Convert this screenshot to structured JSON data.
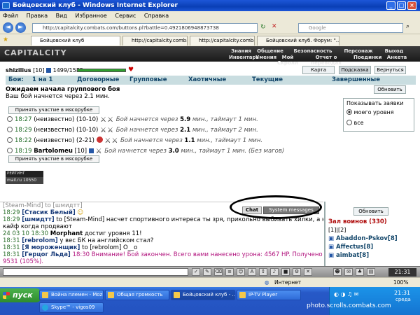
{
  "browser": {
    "title": "Бойцовский клуб - Windows Internet Explorer",
    "menu": [
      "Файл",
      "Правка",
      "Вид",
      "Избранное",
      "Сервис",
      "Справка"
    ],
    "address": "http://capitalcity.combats.com/buttons.pl?battle=0.4921806948873738",
    "search_placeholder": "Google",
    "tabs": [
      "Бойцовский клуб",
      "http://capitalcity.combats.co...",
      "http://capitalcity.combats.co...",
      "Бойцовский клуб. Форум: \"..."
    ]
  },
  "game": {
    "logo": "CAPITALCITY",
    "topnav": [
      "Знания",
      "Общение",
      "Безопасность",
      "Персонаж",
      "Выход",
      "Инвентарь",
      "Умения",
      "Мой Скролл",
      "Отчет о переводах",
      "Поединки",
      "Анкета"
    ],
    "user": {
      "name": "shizilius",
      "level": "[10]",
      "hp": "1499/1585"
    },
    "top_buttons": [
      "Карта миров",
      "Подсказка",
      "Вернуться"
    ],
    "battle_tabs": [
      "Бои:",
      "1 на 1",
      "Договорные",
      "Групповые",
      "Хаотичные",
      "Текущие",
      "Завершенные"
    ],
    "wait_title": "Ожидаем начала группового боя",
    "wait_sub": "Ваш бой начнется через 2.1 мин.",
    "refresh": "Обновить",
    "show_requests": {
      "title": "Показывать заявки",
      "options": [
        "моего уровня",
        "все"
      ]
    },
    "join_label": "Принять участие в мясорубке",
    "rows": [
      {
        "time": "18:27",
        "who": "(неизвестно)",
        "lv": "(10-10)",
        "info": "Бой начнется через",
        "mins": "5.9",
        "rest": "мин., таймаут 1 мин."
      },
      {
        "time": "18:29",
        "who": "(неизвестно)",
        "lv": "(10-10)",
        "info": "Бой начнется через",
        "mins": "2.1",
        "rest": "мин., таймаут 2 мин."
      },
      {
        "time": "18:22",
        "who": "(неизвестно)",
        "lv": "(2-21)",
        "info": "Бой начнется через",
        "mins": "1.1",
        "rest": "мин., таймаут 1 мин."
      },
      {
        "time": "18:19",
        "who": "Bartolomeu",
        "lv": "[10]",
        "info": "Бой начнется через",
        "mins": "3.0",
        "rest": "мин., таймаут 1 мин. (Без магов)"
      }
    ],
    "ratings": [
      "РЕЙТИНГ 146234666",
      "mail.ru 10550"
    ]
  },
  "chat": {
    "tabs": [
      "Chat",
      "System messages"
    ],
    "lines": [
      {
        "t": "",
        "n": "[Steam-Mind] to [шмидтт]",
        "m": ""
      },
      {
        "t": "18:29",
        "n": "[Стасик Белый]",
        "m": ""
      },
      {
        "t": "18:29",
        "n": "[шмидтт]",
        "m": "to [Steam-Mind] насчет спортивного интереса ты зря, прикольно выбивать хилки, а какой"
      },
      {
        "t": "",
        "n": "",
        "m": "кайф когда продвают"
      },
      {
        "t": "24 03 10 18:30",
        "n": "Morphant",
        "m": "достиг уровня 11!"
      },
      {
        "t": "18:31",
        "n": "[rebrolom]",
        "m": "у вес БК на английском стал?"
      },
      {
        "t": "18:31",
        "n": "[Я мороженщик]",
        "m": "to [rebrolom] O__o"
      },
      {
        "t": "18:31",
        "n": "[Герцог Льда]",
        "m": "18:30 Внимание! Бой закончен. Всего вами нанесено урона: 4567 HP. Получено опыта:"
      },
      {
        "t": "",
        "n": "",
        "m": "9531 (105%)."
      }
    ],
    "side": {
      "refresh": "Обновить",
      "room": "Зал воинов (330)",
      "pages": "[1]|[2]",
      "users": [
        "Abaddon-Pskov[8]",
        "Affectus[8]",
        "aimbat[8]"
      ]
    }
  },
  "statusbar": {
    "zone": "Интернет",
    "zoom": "100%"
  },
  "taskbar": {
    "start": "пуск",
    "tasks": [
      "Война племен - Mozilla...",
      "Общая громкость",
      "Бойцовский клуб - ...",
      "IP-TV Player",
      "Skype™ - vigos09"
    ],
    "time": "21:31",
    "day": "среда",
    "watermark": "photo.scrolls.combats.com"
  },
  "colors": {
    "accent": "#1c56d8",
    "hp": "#2ea02e",
    "tabrow": "#c9dde0",
    "chat_time": "#2a6f2a"
  }
}
